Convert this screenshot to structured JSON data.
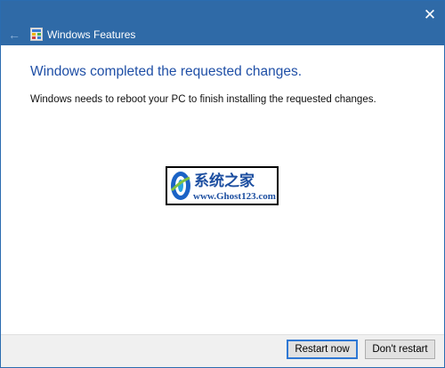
{
  "window": {
    "title": "Windows Features",
    "accent_color": "#2f6aa7",
    "icons": {
      "back": "back-arrow-icon",
      "close": "close-icon",
      "app": "windows-features-icon"
    }
  },
  "content": {
    "heading": "Windows completed the requested changes.",
    "message": "Windows needs to reboot your PC to finish installing the requested changes."
  },
  "watermark": {
    "text_cn": "系统之家",
    "url": "www.Ghost123.com"
  },
  "buttons": {
    "restart_now": "Restart now",
    "dont_restart": "Don't restart"
  }
}
